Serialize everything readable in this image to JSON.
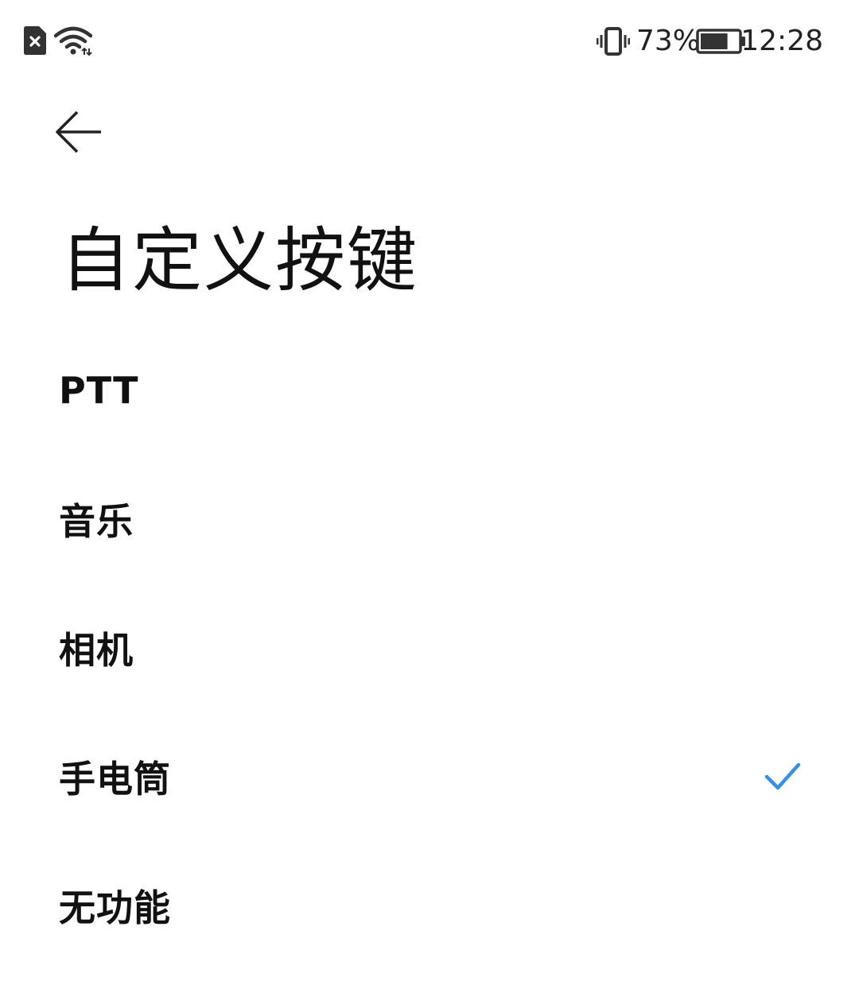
{
  "status_bar": {
    "icons": [
      "sim-card-icon",
      "wifi-icon",
      "vibrate-icon",
      "battery-icon"
    ],
    "battery_percent": "73%",
    "battery_level": 0.73,
    "time": "12:28"
  },
  "header": {
    "back_icon": "back-arrow-icon",
    "title": "自定义按键"
  },
  "options": [
    {
      "label": "PTT",
      "selected": false
    },
    {
      "label": "音乐",
      "selected": false
    },
    {
      "label": "相机",
      "selected": false
    },
    {
      "label": "手电筒",
      "selected": true
    },
    {
      "label": "无功能",
      "selected": false
    }
  ],
  "colors": {
    "accent": "#3b8fe0",
    "text": "#111111",
    "background": "#ffffff"
  }
}
